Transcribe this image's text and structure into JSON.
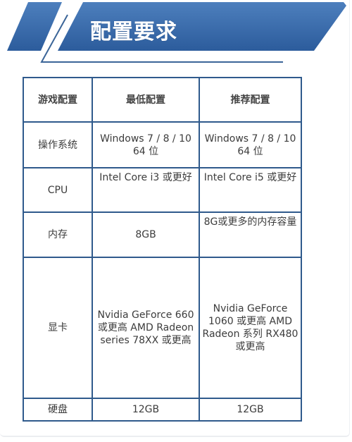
{
  "header": {
    "title": "配置要求",
    "colors": {
      "banner_light": "#4d7fbd",
      "banner_dark": "#2c5c9c",
      "line": "#3b6598",
      "border": "#2f5a8c"
    }
  },
  "table": {
    "columns": [
      "游戏配置",
      "最低配置",
      "推荐配置"
    ],
    "rows": [
      {
        "label": "操作系统",
        "min": "Windows 7 / 8 / 10 64 位",
        "rec": "Windows 7 / 8 / 10 64 位"
      },
      {
        "label": "CPU",
        "min": "Intel Core i3 或更好",
        "rec": "Intel Core i5 或更好"
      },
      {
        "label": "内存",
        "min": "8GB",
        "rec": "8G或更多的内存容量"
      },
      {
        "label": "显卡",
        "min": "Nvidia GeForce 660 或更高 AMD Radeon series 78XX 或更高",
        "rec": "Nvidia GeForce 1060 或更高 AMD Radeon 系列 RX480 或更高"
      },
      {
        "label": "硬盘",
        "min": "12GB",
        "rec": "12GB"
      }
    ]
  }
}
